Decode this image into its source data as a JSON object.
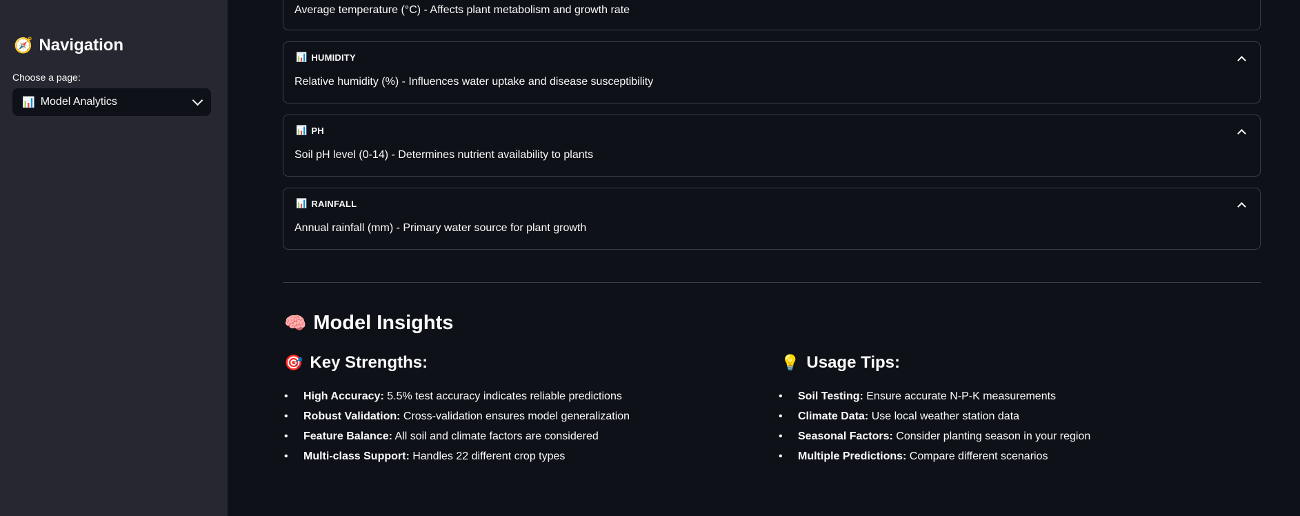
{
  "sidebar": {
    "title_emoji": "🧭",
    "title": "Navigation",
    "choose_label": "Choose a page:",
    "selected_emoji": "📊",
    "selected_page": "Model Analytics"
  },
  "features": {
    "top_partial_text": "Average temperature (°C) - Affects plant metabolism and growth rate",
    "items": [
      {
        "emoji": "📊",
        "name": "HUMIDITY",
        "description": "Relative humidity (%) - Influences water uptake and disease susceptibility"
      },
      {
        "emoji": "📊",
        "name": "PH",
        "description": "Soil pH level (0-14) - Determines nutrient availability to plants"
      },
      {
        "emoji": "📊",
        "name": "RAINFALL",
        "description": "Annual rainfall (mm) - Primary water source for plant growth"
      }
    ]
  },
  "insights": {
    "title_emoji": "🧠",
    "title": "Model Insights",
    "strengths": {
      "emoji": "🎯",
      "title": "Key Strengths:",
      "items": [
        {
          "bold": "High Accuracy:",
          "text": " 5.5% test accuracy indicates reliable predictions"
        },
        {
          "bold": "Robust Validation:",
          "text": " Cross-validation ensures model generalization"
        },
        {
          "bold": "Feature Balance:",
          "text": " All soil and climate factors are considered"
        },
        {
          "bold": "Multi-class Support:",
          "text": " Handles 22 different crop types"
        }
      ]
    },
    "tips": {
      "emoji": "💡",
      "title": "Usage Tips:",
      "items": [
        {
          "bold": "Soil Testing:",
          "text": " Ensure accurate N-P-K measurements"
        },
        {
          "bold": "Climate Data:",
          "text": " Use local weather station data"
        },
        {
          "bold": "Seasonal Factors:",
          "text": " Consider planting season in your region"
        },
        {
          "bold": "Multiple Predictions:",
          "text": " Compare different scenarios"
        }
      ]
    }
  }
}
